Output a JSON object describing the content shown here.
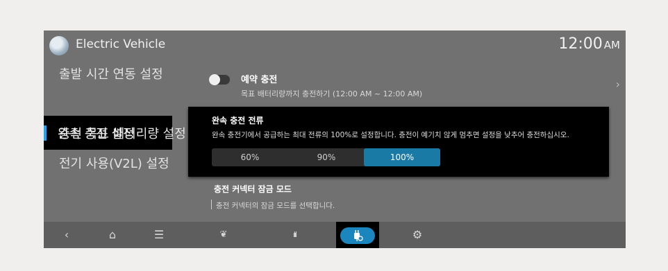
{
  "topbar": {
    "title": "Electric Vehicle",
    "time": "12:00",
    "ampm": "AM"
  },
  "menu": {
    "items": [
      {
        "label": "출발 시간 연동 설정"
      },
      {
        "label": "완속 충전 설정",
        "active": true
      },
      {
        "label": "충전 목표 배터리량 설정"
      },
      {
        "label": "전기 사용(V2L) 설정"
      }
    ]
  },
  "reservation": {
    "title": "예약 충전",
    "description": "목표 배터리량까지 충전하기 (12:00 AM ~ 12:00 AM)",
    "enabled": false,
    "chevron": "›"
  },
  "current_popup": {
    "title": "완속 충전 전류",
    "description": "완속 충전기에서 공급하는 최대 전류의 100%로 설정합니다. 충전이 예기치 않게 멈추면 설정을 낮추어 충전하십시오.",
    "options": [
      "60%",
      "90%",
      "100%"
    ],
    "selected": "100%"
  },
  "lock_mode": {
    "title": "충전 커넥터 잠금 모드",
    "description": "충전 커넥터의 잠금 모드를 선택합니다."
  },
  "navbar": {
    "icons": [
      "back-icon",
      "home-icon",
      "menu-icon",
      "eco-leaf-icon",
      "chart-icon",
      "ev-charge-settings-icon",
      "gear-icon"
    ],
    "glyphs": {
      "back": "‹",
      "home": "⌂",
      "menu": "☰",
      "leaf": "❦",
      "chart": "ılıl",
      "gear": "⚙"
    }
  },
  "colors": {
    "accent": "#1b86bd",
    "active_bar": "#1fa2ff",
    "screen_bg": "#717171"
  }
}
